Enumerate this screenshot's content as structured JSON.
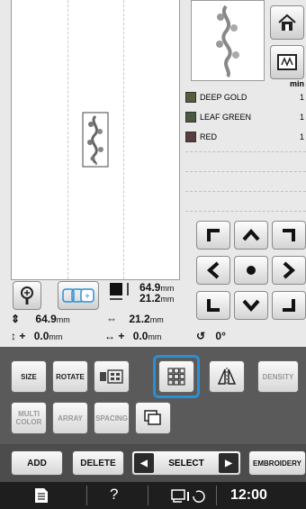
{
  "colors": {
    "accent": "#2a8fd6",
    "panel": "#5a5a5a",
    "deep_gold": "#5b5a3c",
    "leaf_green": "#4a5a42",
    "red": "#5a3c3c"
  },
  "threads": {
    "header": "min",
    "items": [
      {
        "name": "DEEP GOLD",
        "time": "1"
      },
      {
        "name": "LEAF GREEN",
        "time": "1"
      },
      {
        "name": "RED",
        "time": "1"
      }
    ]
  },
  "size_info": {
    "width_value": "64.9",
    "height_value": "21.2",
    "unit": "mm"
  },
  "dimensions": {
    "height": "64.9",
    "width": "21.2",
    "unit": "mm"
  },
  "position": {
    "y_prefix": "+",
    "y_value": "0.0",
    "x_prefix": "+",
    "x_value": "0.0",
    "unit": "mm",
    "angle": "0°"
  },
  "buttons": {
    "size": "SIZE",
    "rotate": "ROTATE",
    "density": "DENSITY",
    "multi_color": "MULTI COLOR",
    "array": "ARRAY",
    "spacing": "SPACING"
  },
  "bottom": {
    "add": "ADD",
    "delete": "DELETE",
    "select": "SELECT",
    "embroidery": "EMBROIDERY"
  },
  "status": {
    "help": "?",
    "time": "12:00"
  }
}
